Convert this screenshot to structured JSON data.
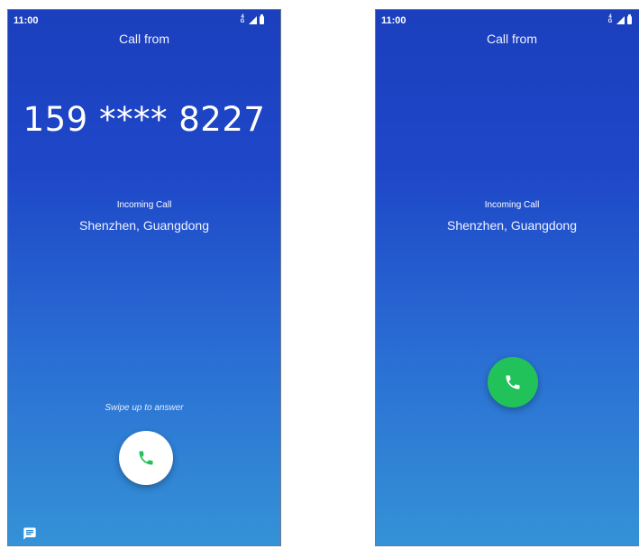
{
  "screens": [
    {
      "status_time": "11:00",
      "network_label": "4G",
      "header": "Call from",
      "caller_number": "159 **** 8227",
      "call_status": "Incoming Call",
      "location": "Shenzhen, Guangdong",
      "hint": "Swipe up to answer",
      "answer_icon": "phone-icon",
      "message_icon": "message-icon"
    },
    {
      "status_time": "11:00",
      "network_label": "4G",
      "header": "Call from",
      "call_status": "Incoming Call",
      "location": "Shenzhen, Guangdong",
      "answer_icon": "phone-icon"
    }
  ],
  "colors": {
    "background_top": "#1b3fbd",
    "background_bottom": "#3592d6",
    "answer_green": "#21c25a",
    "answer_white": "#ffffff",
    "text": "#ffffff"
  }
}
